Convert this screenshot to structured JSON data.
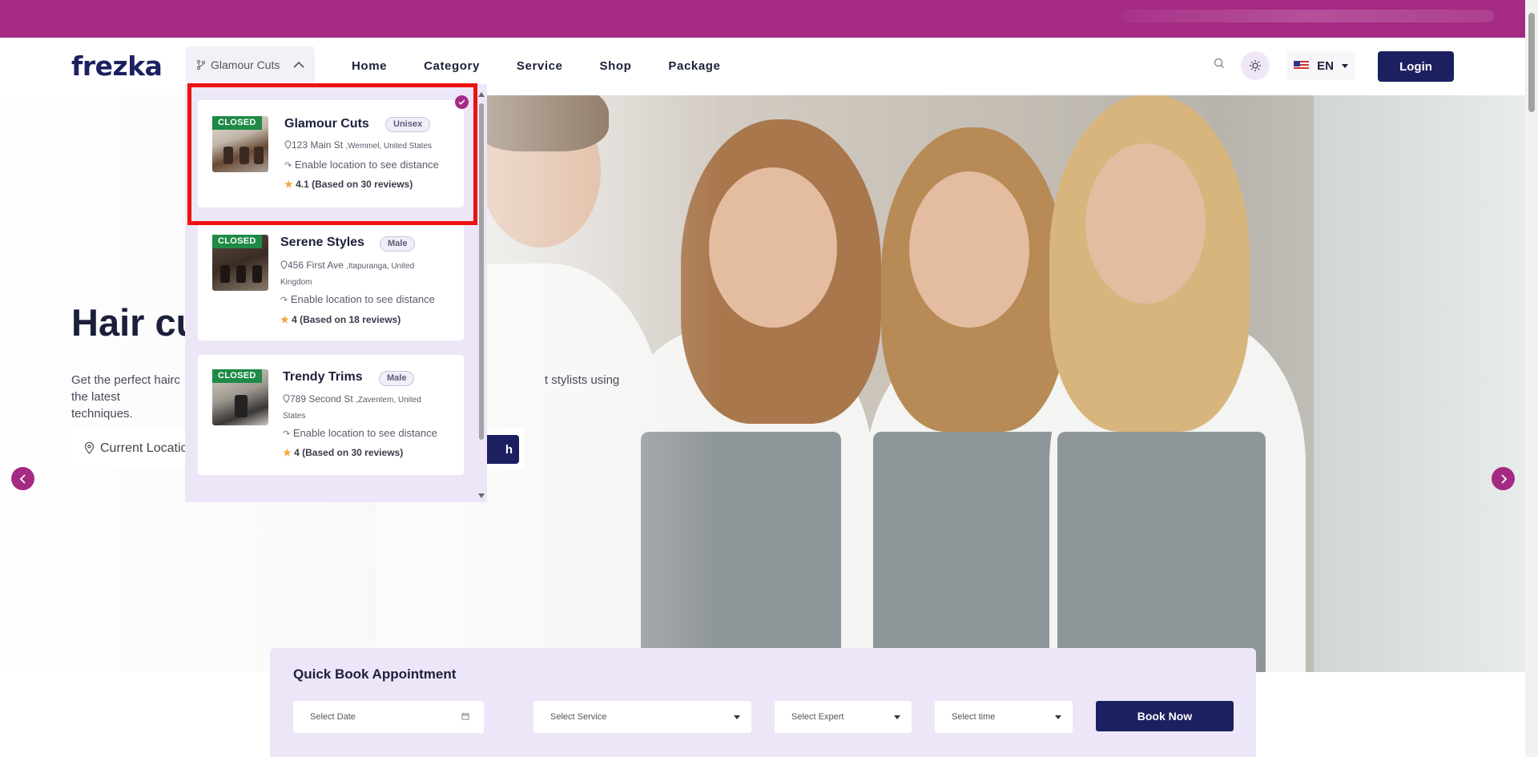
{
  "header": {
    "logo": "frezka",
    "branch_selector": "Glamour Cuts",
    "nav": [
      "Home",
      "Category",
      "Service",
      "Shop",
      "Package"
    ],
    "language": "EN",
    "login_label": "Login"
  },
  "hero": {
    "title": "Hair cu",
    "subtitle_start": "Get the perfect hairc",
    "subtitle_end": "t stylists using the latest",
    "subtitle_line2": "techniques.",
    "location_label": "Current Locatic",
    "search_label": "h"
  },
  "branches": [
    {
      "status": "CLOSED",
      "name": "Glamour Cuts",
      "tag": "Unisex",
      "street": "123 Main St",
      "city": ",Wemmel, United States",
      "distance": "Enable location to see distance",
      "rating": "4.1",
      "reviews": "(Based on 30 reviews)",
      "selected": true
    },
    {
      "status": "CLOSED",
      "name": "Serene Styles",
      "tag": "Male",
      "street": "456 First Ave",
      "city": ",Itapuranga, United Kingdom",
      "distance": "Enable location to see distance",
      "rating": "4",
      "reviews": "(Based on 18 reviews)",
      "selected": false
    },
    {
      "status": "CLOSED",
      "name": "Trendy Trims",
      "tag": "Male",
      "street": "789 Second St",
      "city": ",Zaventem, United States",
      "distance": "Enable location to see distance",
      "rating": "4",
      "reviews": "(Based on 30 reviews)",
      "selected": false
    }
  ],
  "quick_book": {
    "title": "Quick Book Appointment",
    "date_placeholder": "Select Date",
    "service_placeholder": "Select Service",
    "expert_placeholder": "Select Expert",
    "time_placeholder": "Select time",
    "book_label": "Book Now"
  },
  "colors": {
    "brand_purple": "#a52a84",
    "navy": "#1d2060",
    "closed_green": "#1e8a46",
    "highlight_red": "#ee1111"
  }
}
